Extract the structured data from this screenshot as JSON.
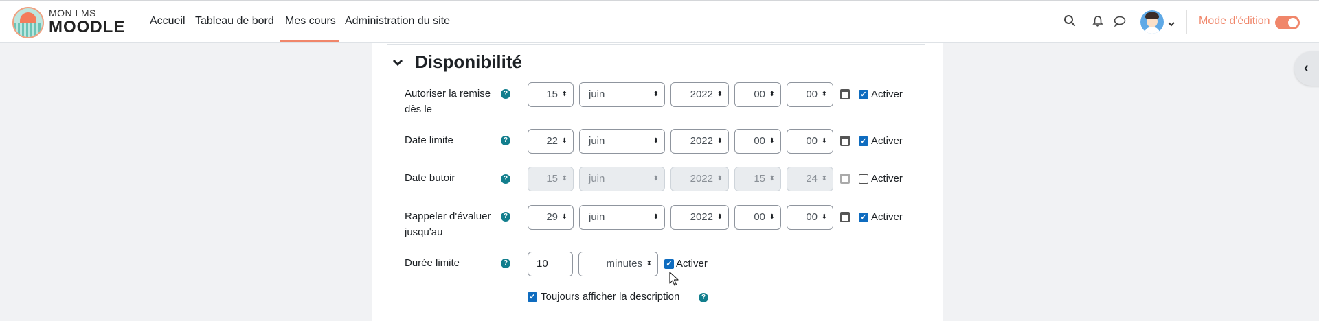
{
  "header": {
    "brand_top": "MON LMS",
    "brand_bottom": "MOODLE",
    "nav": [
      {
        "label": "Accueil"
      },
      {
        "label": "Tableau de bord"
      },
      {
        "label": "Mes cours",
        "active": true
      },
      {
        "label": "Administration du site"
      }
    ],
    "edit_mode_label": "Mode d'édition",
    "edit_mode_on": true
  },
  "section": {
    "title": "Disponibilité",
    "rows": [
      {
        "label": "Autoriser la remise dès le",
        "day": "15",
        "month": "juin",
        "year": "2022",
        "hour": "00",
        "minute": "00",
        "enable_label": "Activer",
        "enabled": true
      },
      {
        "label": "Date limite",
        "day": "22",
        "month": "juin",
        "year": "2022",
        "hour": "00",
        "minute": "00",
        "enable_label": "Activer",
        "enabled": true
      },
      {
        "label": "Date butoir",
        "day": "15",
        "month": "juin",
        "year": "2022",
        "hour": "15",
        "minute": "24",
        "enable_label": "Activer",
        "enabled": false
      },
      {
        "label": "Rappeler d'évaluer jusqu'au",
        "day": "29",
        "month": "juin",
        "year": "2022",
        "hour": "00",
        "minute": "00",
        "enable_label": "Activer",
        "enabled": true
      }
    ],
    "time_limit": {
      "label": "Durée limite",
      "value": "10",
      "unit": "minutes",
      "enable_label": "Activer",
      "enabled": true
    },
    "always_show_description": {
      "label": "Toujours afficher la description",
      "checked": true
    }
  },
  "colors": {
    "accent": "#f0866a",
    "checkbox": "#0f6cbf",
    "help_icon": "#127e8d"
  }
}
